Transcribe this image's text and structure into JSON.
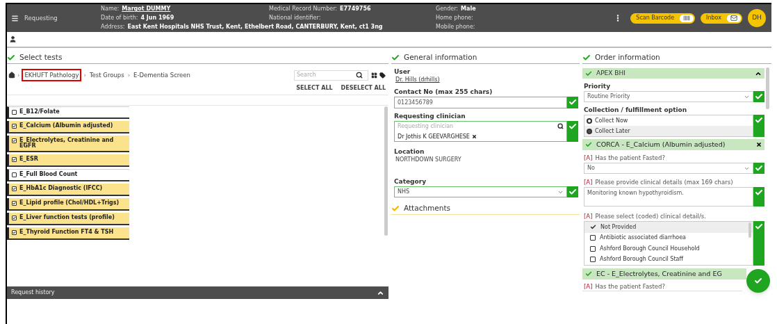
{
  "header": {
    "menu_label": "Requesting",
    "fields": [
      {
        "label": "Name:",
        "value": "Margot DUMMY",
        "link": true
      },
      {
        "label": "Medical Record Number:",
        "value": "E7749756"
      },
      {
        "label": "Gender:",
        "value": "Male"
      },
      {
        "label": "Date of birth:",
        "value": "4 Jun 1969"
      },
      {
        "label": "National identifier:"
      },
      {
        "label": "Home phone:"
      },
      {
        "label": "Address:",
        "value": "East Kent Hospitals NHS Trust, Kent, Ethelbert Road, CANTERBURY, Kent, ct1 3ng",
        "wide": true
      },
      {
        "label": "Mobile phone:"
      }
    ],
    "scan_button": "Scan Barcode",
    "inbox_button": "Inbox",
    "avatar": "DH"
  },
  "select_tests": {
    "title": "Select tests",
    "complete": true,
    "breadcrumb": [
      {
        "separator": "›",
        "label": "EKHUFT Pathology",
        "highlighted": true
      },
      {
        "separator": "›",
        "label": "Test Groups",
        "highlighted": false
      },
      {
        "separator": "›",
        "label": "E-Dementia Screen",
        "highlighted": false
      }
    ],
    "search": {
      "placeholder": "Search"
    },
    "select_all": "SELECT ALL",
    "deselect_all": "DESELECT ALL",
    "tests": [
      {
        "label": "E_B12/Folate",
        "checked": false
      },
      {
        "label": "E_Calcium (Albumin adjusted)",
        "checked": true
      },
      {
        "label": "E_Electrolytes, Creatinine and EGFR",
        "checked": true
      },
      {
        "label": "E_ESR",
        "checked": true
      },
      {
        "label": "E_Full Blood Count",
        "checked": false
      },
      {
        "label": "E_HbA1c Diagnostic (IFCC)",
        "checked": true
      },
      {
        "label": "E_Lipid profile (Chol/HDL+Trigs)",
        "checked": true
      },
      {
        "label": "E_Liver function tests (profile)",
        "checked": true
      },
      {
        "label": "E_Thyroid Function FT4 & TSH",
        "checked": true
      }
    ]
  },
  "request_history": {
    "title": "Request history"
  },
  "general_information": {
    "title": "General information",
    "complete": true,
    "user_label": "User",
    "user_value": "Dr. Hills (drhills)",
    "contact_label": "Contact No (max 255 chars)",
    "contact_value": "0123456789",
    "clinician_label": "Requesting clinician",
    "clinician_placeholder": "Requesting clinician",
    "clinician_chip": "Dr Jothis K GEEVARGHESE",
    "location_label": "Location",
    "location_value": "NORTHDOWN SURGERY",
    "category_label": "Category",
    "category_value": "NHS",
    "attachments": {
      "title": "Attachments",
      "complete": false
    }
  },
  "order_information": {
    "title": "Order information",
    "complete": true,
    "apex": {
      "title": "APEX BHI",
      "expanded": true,
      "priority_label": "Priority",
      "priority_value": "Routine Priority",
      "collection_label": "Collection / fulfillment option",
      "collection_options": [
        {
          "label": "Collect Now",
          "selected": false
        },
        {
          "label": "Collect Later",
          "selected": true
        }
      ]
    },
    "corca": {
      "title": "CORCA - E_Calcium (Albumin adjusted)",
      "fasted_tag": "[A]",
      "fasted_label": "Has the patient Fasted?",
      "fasted_value": "No",
      "details_tag": "[A]",
      "details_label": "Please provide clinical details (max 169 chars)",
      "details_value": "Monitoring known hypothyroidism.",
      "coded_tag": "[A]",
      "coded_label": "Please select (coded) clinical detail/s.",
      "coded_options": [
        {
          "label": "Not Provided",
          "checked": true
        },
        {
          "label": "Antibiotic associated diarrhoea",
          "checked": false
        },
        {
          "label": "Ashford Borough Council Household",
          "checked": false
        },
        {
          "label": "Ashford Borough Council Staff",
          "checked": false
        }
      ]
    },
    "ec": {
      "title": "EC - E_Electrolytes, Creatinine and EG",
      "fasted_tag": "[A]",
      "fasted_label": "Has the patient Fasted?"
    }
  }
}
